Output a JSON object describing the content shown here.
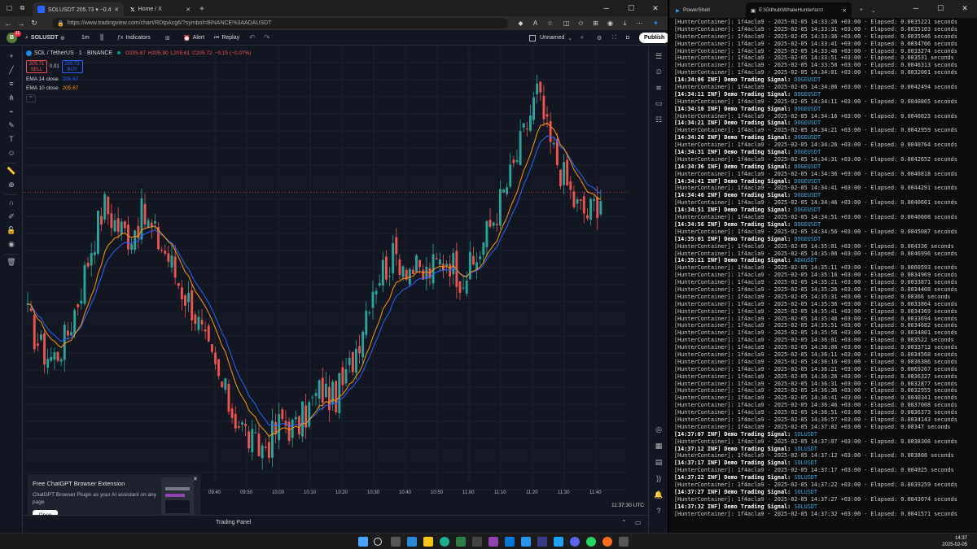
{
  "browser": {
    "tabs": [
      {
        "label": "SOLUSDT 205.73 ▾ −0.44% Unnamed"
      },
      {
        "label": "Home / X"
      }
    ],
    "new_tab": "+",
    "url": "https://www.tradingview.com/chart/RDtpAcg6/?symbol=BINANCE%3AADAUSDT"
  },
  "tv": {
    "avatar_badge": "11",
    "symbol": "SOLUSDT",
    "interval": "1m",
    "indicators_label": "Indicators",
    "alert_label": "Alert",
    "replay_label": "Replay",
    "layout_name": "Unnamed",
    "publish_label": "Publish",
    "legend": {
      "title": "SOL / TetherUS · 1 · BINANCE",
      "o": "O205.87",
      "h": "H205.90",
      "l": "L205.61",
      "c": "C205.72",
      "chg": "−0.15 (−0.07%)",
      "sell_price": "205.71",
      "sell_label": "SELL",
      "spread": "0.01",
      "buy_price": "205.72",
      "buy_label": "BUY",
      "ema14_label": "EMA 14 close",
      "ema14_value": "205.67",
      "ema10_label": "EMA 10 close",
      "ema10_value": "205.67"
    },
    "price_axis": {
      "currency": "USDT",
      "ticks": [
        "207.00",
        "206.80",
        "206.60",
        "206.40",
        "206.20",
        "206.00",
        "205.80",
        "205.60",
        "205.40",
        "205.20",
        "205.00",
        "204.80",
        "204.60",
        "204.45",
        "204.30",
        "204.15",
        "204.00",
        "203.85",
        "203.70",
        "203.55",
        "203.40",
        "203.28",
        "203.16",
        "203.04",
        "202.92",
        "202.80"
      ],
      "last_price": "205.72",
      "countdown": "00:30"
    },
    "time_axis": [
      "09:40",
      "09:50",
      "10:00",
      "10:10",
      "10:20",
      "10:30",
      "10:40",
      "10:50",
      "11:00",
      "11:10",
      "11:20",
      "11:30",
      "11:40"
    ],
    "clock": "11:37:30 UTC",
    "bottom_label": "Trading Panel",
    "promo": {
      "title": "Free ChatGPT Browser Extension",
      "body": "ChatGPT Browser Plugin as your AI assistant on any page",
      "button": "Open"
    },
    "colors": {
      "up": "#26a69a",
      "down": "#ef5350",
      "ema14": "#2962ff",
      "ema10": "#ff9800",
      "bg": "#131722"
    }
  },
  "chart_data": {
    "type": "candlestick",
    "symbol": "SOL / TetherUS · 1 · BINANCE",
    "ylim": [
      202.8,
      207.05
    ],
    "x_ticks": [
      "09:40",
      "09:50",
      "10:00",
      "10:10",
      "10:20",
      "10:30",
      "10:40",
      "10:50",
      "11:00",
      "11:10",
      "11:20",
      "11:30",
      "11:40"
    ],
    "series": [
      {
        "name": "EMA 14 close"
      },
      {
        "name": "EMA 10 close"
      }
    ],
    "close_samples": [
      204.5,
      204.2,
      204.1,
      204.3,
      204.7,
      205.2,
      205.6,
      205.4,
      205.3,
      205.5,
      205.3,
      205.1,
      204.8,
      204.6,
      204.2,
      203.9,
      203.6,
      203.4,
      203.2,
      203.3,
      203.5,
      203.4,
      203.6,
      203.8,
      203.7,
      203.9,
      204.3,
      204.8,
      205.0,
      205.1,
      205.0,
      204.9,
      205.0,
      205.1,
      204.9,
      205.0,
      205.3,
      205.6,
      205.9,
      206.3,
      206.7,
      206.2,
      205.9,
      205.6,
      205.5,
      205.7
    ]
  },
  "terminal": {
    "tabs": [
      {
        "label": "PowerShell"
      },
      {
        "label": "E:\\Github\\WhaleHunter\\src\\"
      }
    ],
    "lines": [
      {
        "t": "[HunterContainer]: 1f4acla9 - 2025-02-05 14:33:26 +03:00 - Elapsed: 0.0035221 seconds"
      },
      {
        "t": "[HunterContainer]: 1f4acla9 - 2025-02-05 14:33:31 +03:00 - Elapsed: 0.0035103 seconds"
      },
      {
        "t": "[HunterContainer]: 1f4acla9 - 2025-02-05 14:33:36 +03:00 - Elapsed: 0.0035946 seconds"
      },
      {
        "t": "[HunterContainer]: 1f4acla9 - 2025-02-05 14:33:41 +03:00 - Elapsed: 0.0034706 seconds"
      },
      {
        "t": "[HunterContainer]: 1f4acla9 - 2025-02-05 14:33:46 +03:00 - Elapsed: 0.0033274 seconds"
      },
      {
        "t": "[HunterContainer]: 1f4acla9 - 2025-02-05 14:33:51 +03:00 - Elapsed: 0.003531 seconds"
      },
      {
        "t": "[HunterContainer]: 1f4acla9 - 2025-02-05 14:33:56 +03:00 - Elapsed: 0.0046313 seconds"
      },
      {
        "t": "[HunterContainer]: 1f4acla9 - 2025-02-05 14:34:01 +03:00 - Elapsed: 0.0032061 seconds"
      },
      {
        "t": "[14:34:06 INF] Demo Trading Signal: ",
        "s": "DOGEUSDT"
      },
      {
        "t": "[HunterContainer]: 1f4acla9 - 2025-02-05 14:34:06 +03:00 - Elapsed: 0.0042494 seconds"
      },
      {
        "t": "[14:34:11 INF] Demo Trading Signal: ",
        "s": "DOGEUSDT"
      },
      {
        "t": "[HunterContainer]: 1f4acla9 - 2025-02-05 14:34:11 +03:00 - Elapsed: 0.0040865 seconds"
      },
      {
        "t": "[14:34:16 INF] Demo Trading Signal: ",
        "s": "DOGEUSDT"
      },
      {
        "t": "[HunterContainer]: 1f4acla9 - 2025-02-05 14:34:16 +03:00 - Elapsed: 0.0040023 seconds"
      },
      {
        "t": "[14:34:21 INF] Demo Trading Signal: ",
        "s": "DOGEUSDT"
      },
      {
        "t": "[HunterContainer]: 1f4acla9 - 2025-02-05 14:34:21 +03:00 - Elapsed: 0.0042959 seconds"
      },
      {
        "t": "[14:34:26 INF] Demo Trading Signal: ",
        "s": "DOGEUSDT"
      },
      {
        "t": "[HunterContainer]: 1f4acla9 - 2025-02-05 14:34:26 +03:00 - Elapsed: 0.0040764 seconds"
      },
      {
        "t": "[14:34:31 INF] Demo Trading Signal: ",
        "s": "DOGEUSDT"
      },
      {
        "t": "[HunterContainer]: 1f4acla9 - 2025-02-05 14:34:31 +03:00 - Elapsed: 0.0042652 seconds"
      },
      {
        "t": "[14:34:36 INF] Demo Trading Signal: ",
        "s": "DOGEUSDT"
      },
      {
        "t": "[HunterContainer]: 1f4acla9 - 2025-02-05 14:34:36 +03:00 - Elapsed: 0.0040818 seconds"
      },
      {
        "t": "[14:34:41 INF] Demo Trading Signal: ",
        "s": "DOGEUSDT"
      },
      {
        "t": "[HunterContainer]: 1f4acla9 - 2025-02-05 14:34:41 +03:00 - Elapsed: 0.0044291 seconds"
      },
      {
        "t": "[14:34:46 INF] Demo Trading Signal: ",
        "s": "DOGEUSDT"
      },
      {
        "t": "[HunterContainer]: 1f4acla9 - 2025-02-05 14:34:46 +03:00 - Elapsed: 0.0040661 seconds"
      },
      {
        "t": "[14:34:51 INF] Demo Trading Signal: ",
        "s": "DOGEUSDT"
      },
      {
        "t": "[HunterContainer]: 1f4acla9 - 2025-02-05 14:34:51 +03:00 - Elapsed: 0.0040608 seconds"
      },
      {
        "t": "[14:34:56 INF] Demo Trading Signal: ",
        "s": "DOGEUSDT"
      },
      {
        "t": "[HunterContainer]: 1f4acla9 - 2025-02-05 14:34:56 +03:00 - Elapsed: 0.0045087 seconds"
      },
      {
        "t": "[14:35:01 INF] Demo Trading Signal: ",
        "s": "DOGEUSDT"
      },
      {
        "t": "[HunterContainer]: 1f4acla9 - 2025-02-05 14:35:01 +03:00 - Elapsed: 0.004336 seconds"
      },
      {
        "t": "[HunterContainer]: 1f4acla9 - 2025-02-05 14:35:06 +03:00 - Elapsed: 0.0046996 seconds"
      },
      {
        "t": "[14:35:11 INF] Demo Trading Signal: ",
        "s": "ADAUSDT"
      },
      {
        "t": "[HunterContainer]: 1f4acla9 - 2025-02-05 14:35:11 +03:00 - Elapsed: 0.0060593 seconds"
      },
      {
        "t": "[HunterContainer]: 1f4acla9 - 2025-02-05 14:35:16 +03:00 - Elapsed: 0.0034969 seconds"
      },
      {
        "t": "[HunterContainer]: 1f4acla9 - 2025-02-05 14:35:21 +03:00 - Elapsed: 0.0033871 seconds"
      },
      {
        "t": "[HunterContainer]: 1f4acla9 - 2025-02-05 14:35:26 +03:00 - Elapsed: 0.0034408 seconds"
      },
      {
        "t": "[HunterContainer]: 1f4acla9 - 2025-02-05 14:35:31 +03:00 - Elapsed: 0.00366 seconds"
      },
      {
        "t": "[HunterContainer]: 1f4acla9 - 2025-02-05 14:35:36 +03:00 - Elapsed: 0.0033864 seconds"
      },
      {
        "t": "[HunterContainer]: 1f4acla9 - 2025-02-05 14:35:41 +03:00 - Elapsed: 0.0034369 seconds"
      },
      {
        "t": "[HunterContainer]: 1f4acla9 - 2025-02-05 14:35:46 +03:00 - Elapsed: 0.0033694 seconds"
      },
      {
        "t": "[HunterContainer]: 1f4acla9 - 2025-02-05 14:35:51 +03:00 - Elapsed: 0.0034682 seconds"
      },
      {
        "t": "[HunterContainer]: 1f4acla9 - 2025-02-05 14:35:56 +03:00 - Elapsed: 0.0034801 seconds"
      },
      {
        "t": "[HunterContainer]: 1f4acla9 - 2025-02-05 14:36:01 +03:00 - Elapsed: 0.003522 seconds"
      },
      {
        "t": "[HunterContainer]: 1f4acla9 - 2025-02-05 14:36:06 +03:00 - Elapsed: 0.0033713 seconds"
      },
      {
        "t": "[HunterContainer]: 1f4acla9 - 2025-02-05 14:36:11 +03:00 - Elapsed: 0.0034568 seconds"
      },
      {
        "t": "[HunterContainer]: 1f4acla9 - 2025-02-05 14:36:16 +03:00 - Elapsed: 0.0036386 seconds"
      },
      {
        "t": "[HunterContainer]: 1f4acla9 - 2025-02-05 14:36:21 +03:00 - Elapsed: 0.0069267 seconds"
      },
      {
        "t": "[HunterContainer]: 1f4acla9 - 2025-02-05 14:36:26 +03:00 - Elapsed: 0.0036327 seconds"
      },
      {
        "t": "[HunterContainer]: 1f4acla9 - 2025-02-05 14:36:31 +03:00 - Elapsed: 0.0032877 seconds"
      },
      {
        "t": "[HunterContainer]: 1f4acla9 - 2025-02-05 14:36:36 +03:00 - Elapsed: 0.0032955 seconds"
      },
      {
        "t": "[HunterContainer]: 1f4acla9 - 2025-02-05 14:36:41 +03:00 - Elapsed: 0.0040341 seconds"
      },
      {
        "t": "[HunterContainer]: 1f4acla9 - 2025-02-05 14:36:46 +03:00 - Elapsed: 0.0037008 seconds"
      },
      {
        "t": "[HunterContainer]: 1f4acla9 - 2025-02-05 14:36:51 +03:00 - Elapsed: 0.0036373 seconds"
      },
      {
        "t": "[HunterContainer]: 1f4acla9 - 2025-02-05 14:36:57 +03:00 - Elapsed: 0.0034143 seconds"
      },
      {
        "t": "[HunterContainer]: 1f4acla9 - 2025-02-05 14:37:02 +03:00 - Elapsed: 0.00347 seconds"
      },
      {
        "t": "[14:37:07 INF] Demo Trading Signal: ",
        "s": "SOLUSDT"
      },
      {
        "t": "[HunterContainer]: 1f4acla9 - 2025-02-05 14:37:07 +03:00 - Elapsed: 0.0038308 seconds"
      },
      {
        "t": "[14:37:12 INF] Demo Trading Signal: ",
        "s": "SOLUSDT"
      },
      {
        "t": "[HunterContainer]: 1f4acla9 - 2025-02-05 14:37:12 +03:00 - Elapsed: 0.003808 seconds"
      },
      {
        "t": "[14:37:17 INF] Demo Trading Signal: ",
        "s": "SOLUSDT"
      },
      {
        "t": "[HunterContainer]: 1f4acla9 - 2025-02-05 14:37:17 +03:00 - Elapsed: 0.004925 seconds"
      },
      {
        "t": "[14:37:22 INF] Demo Trading Signal: ",
        "s": "SOLUSDT"
      },
      {
        "t": "[HunterContainer]: 1f4acla9 - 2025-02-05 14:37:22 +03:00 - Elapsed: 0.0039259 seconds"
      },
      {
        "t": "[14:37:27 INF] Demo Trading Signal: ",
        "s": "SOLUSDT"
      },
      {
        "t": "[HunterContainer]: 1f4acla9 - 2025-02-05 14:37:27 +03:00 - Elapsed: 0.0043074 seconds"
      },
      {
        "t": "[14:37:32 INF] Demo Trading Signal: ",
        "s": "SOLUSDT"
      },
      {
        "t": "[HunterContainer]: 1f4acla9 - 2025-02-05 14:37:32 +03:00 - Elapsed: 0.0041571 seconds"
      }
    ]
  },
  "taskbar": {
    "time": "14:37",
    "date": "2025-02-05"
  }
}
